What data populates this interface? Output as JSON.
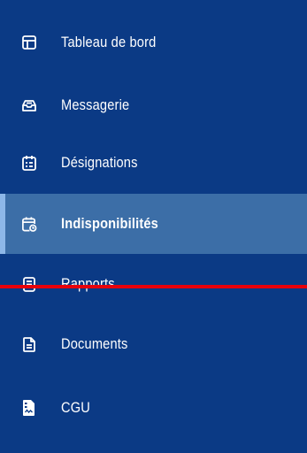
{
  "sidebar": {
    "items": [
      {
        "label": "Tableau de bord",
        "icon": "dashboard-icon",
        "active": false
      },
      {
        "label": "Messagerie",
        "icon": "inbox-icon",
        "active": false
      },
      {
        "label": "Désignations",
        "icon": "calendar-list-icon",
        "active": false
      },
      {
        "label": "Indisponibilités",
        "icon": "calendar-clock-icon",
        "active": true
      },
      {
        "label": "Rapports",
        "icon": "report-icon",
        "active": false
      },
      {
        "label": "Documents",
        "icon": "document-icon",
        "active": false
      },
      {
        "label": "CGU",
        "icon": "signed-document-icon",
        "active": false
      }
    ]
  },
  "colors": {
    "background": "#0b3a85",
    "active_background": "#3c6ea7",
    "active_indicator": "#8db7e8",
    "text": "#ffffff",
    "overlay_line": "#e8000b"
  }
}
